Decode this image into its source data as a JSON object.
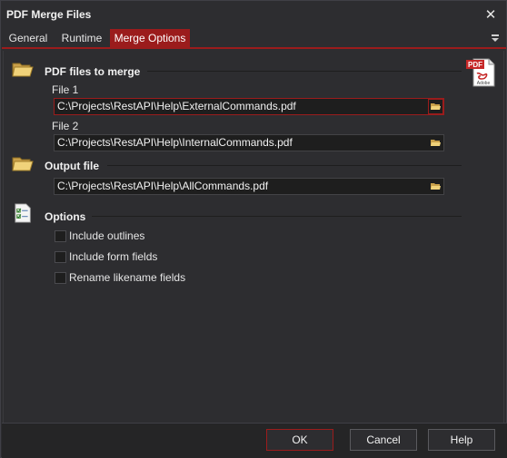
{
  "window": {
    "title": "PDF Merge Files",
    "close_glyph": "✕"
  },
  "tabs": [
    {
      "label": "General",
      "active": false
    },
    {
      "label": "Runtime",
      "active": false
    },
    {
      "label": "Merge Options",
      "active": true
    }
  ],
  "colors": {
    "accent": "#9b1c1c",
    "background": "#2d2d30",
    "field_background": "#1e1e1e",
    "text": "#e6e6e6"
  },
  "sections": {
    "files": {
      "heading": "PDF files to merge",
      "icon": "folder-icon",
      "fields": [
        {
          "label": "File 1",
          "value": "C:\\Projects\\RestAPI\\Help\\ExternalCommands.pdf",
          "focused": true
        },
        {
          "label": "File 2",
          "value": "C:\\Projects\\RestAPI\\Help\\InternalCommands.pdf",
          "focused": false
        }
      ],
      "badge_icon": "adobe-pdf-icon"
    },
    "output": {
      "heading": "Output file",
      "icon": "folder-icon",
      "value": "C:\\Projects\\RestAPI\\Help\\AllCommands.pdf"
    },
    "options": {
      "heading": "Options",
      "icon": "checklist-icon",
      "checkboxes": [
        {
          "label": "Include outlines",
          "checked": false
        },
        {
          "label": "Include form fields",
          "checked": false
        },
        {
          "label": "Rename likename fields",
          "checked": false
        }
      ]
    }
  },
  "footer": {
    "ok_label": "OK",
    "cancel_label": "Cancel",
    "help_label": "Help"
  }
}
